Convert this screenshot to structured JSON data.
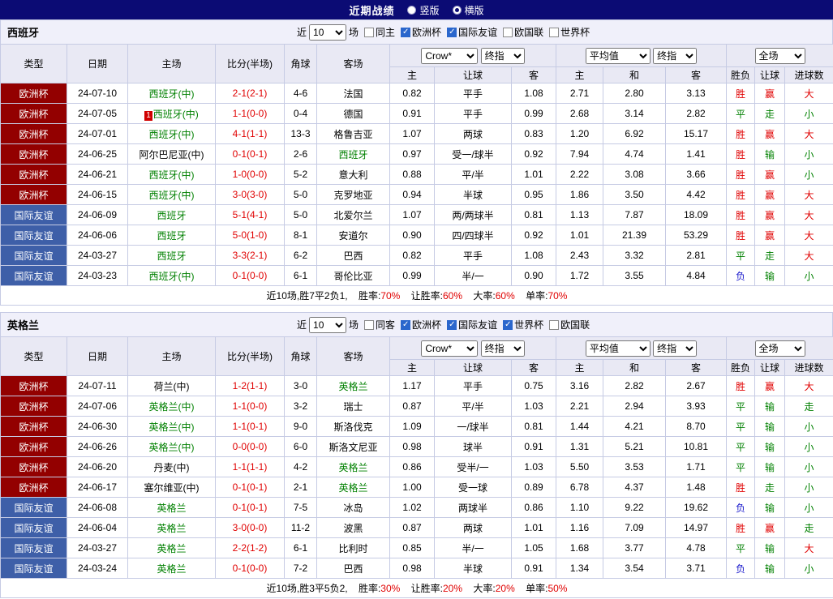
{
  "topbar": {
    "title": "近期战绩",
    "radios": [
      {
        "label": "竖版",
        "checked": false
      },
      {
        "label": "横版",
        "checked": true
      }
    ]
  },
  "table_header": {
    "type": "类型",
    "date": "日期",
    "home": "主场",
    "score": "比分(半场)",
    "corner": "角球",
    "away": "客场",
    "dd_crow": "Crow*",
    "dd_final": "终指",
    "dd_avg": "平均值",
    "dd_full": "全场",
    "sub_home": "主",
    "sub_handicap": "让球",
    "sub_away": "客",
    "sub_avg_home": "主",
    "sub_avg_draw": "和",
    "sub_avg_away": "客",
    "sub_result": "胜负",
    "sub_hresult": "让球",
    "sub_goals": "进球数"
  },
  "colors": {
    "euro_bg": "#930000",
    "friendly_bg": "#3e5fa8",
    "win": "#e00000",
    "draw": "#008000",
    "lose": "#1818cc",
    "topbar_bg": "#0b0b74"
  },
  "sections": [
    {
      "team": "西班牙",
      "filter": {
        "near": "近",
        "count": "10",
        "games": "场",
        "checkboxes": [
          {
            "label": "同主",
            "checked": false
          },
          {
            "label": "欧洲杯",
            "checked": true
          },
          {
            "label": "国际友谊",
            "checked": true
          },
          {
            "label": "欧国联",
            "checked": false
          },
          {
            "label": "世界杯",
            "checked": false
          }
        ]
      },
      "rows": [
        {
          "type": "欧洲杯",
          "type_class": "euro",
          "date": "24-07-10",
          "marker": "",
          "home": "西班牙(中)",
          "home_color": "green",
          "score": "2-1(2-1)",
          "corner": "4-6",
          "away": "法国",
          "away_color": "black",
          "odds_home": "0.82",
          "handicap": "平手",
          "odds_away": "1.08",
          "avg_home": "2.71",
          "avg_draw": "2.80",
          "avg_away": "3.13",
          "result": "胜",
          "result_color": "red",
          "hresult": "赢",
          "hresult_color": "red",
          "goals": "大",
          "goals_color": "red"
        },
        {
          "type": "欧洲杯",
          "type_class": "euro",
          "date": "24-07-05",
          "marker": "1",
          "home": "西班牙(中)",
          "home_color": "green",
          "score": "1-1(0-0)",
          "corner": "0-4",
          "away": "德国",
          "away_color": "black",
          "odds_home": "0.91",
          "handicap": "平手",
          "odds_away": "0.99",
          "avg_home": "2.68",
          "avg_draw": "3.14",
          "avg_away": "2.82",
          "result": "平",
          "result_color": "green",
          "hresult": "走",
          "hresult_color": "green",
          "goals": "小",
          "goals_color": "green"
        },
        {
          "type": "欧洲杯",
          "type_class": "euro",
          "date": "24-07-01",
          "marker": "",
          "home": "西班牙(中)",
          "home_color": "green",
          "score": "4-1(1-1)",
          "corner": "13-3",
          "away": "格鲁吉亚",
          "away_color": "black",
          "odds_home": "1.07",
          "handicap": "两球",
          "odds_away": "0.83",
          "avg_home": "1.20",
          "avg_draw": "6.92",
          "avg_away": "15.17",
          "result": "胜",
          "result_color": "red",
          "hresult": "赢",
          "hresult_color": "red",
          "goals": "大",
          "goals_color": "red"
        },
        {
          "type": "欧洲杯",
          "type_class": "euro",
          "date": "24-06-25",
          "marker": "",
          "home": "阿尔巴尼亚(中)",
          "home_color": "black",
          "score": "0-1(0-1)",
          "corner": "2-6",
          "away": "西班牙",
          "away_color": "green",
          "odds_home": "0.97",
          "handicap": "受一/球半",
          "odds_away": "0.92",
          "avg_home": "7.94",
          "avg_draw": "4.74",
          "avg_away": "1.41",
          "result": "胜",
          "result_color": "red",
          "hresult": "输",
          "hresult_color": "green",
          "goals": "小",
          "goals_color": "green"
        },
        {
          "type": "欧洲杯",
          "type_class": "euro",
          "date": "24-06-21",
          "marker": "",
          "home": "西班牙(中)",
          "home_color": "green",
          "score": "1-0(0-0)",
          "corner": "5-2",
          "away": "意大利",
          "away_color": "black",
          "odds_home": "0.88",
          "handicap": "平/半",
          "odds_away": "1.01",
          "avg_home": "2.22",
          "avg_draw": "3.08",
          "avg_away": "3.66",
          "result": "胜",
          "result_color": "red",
          "hresult": "赢",
          "hresult_color": "red",
          "goals": "小",
          "goals_color": "green"
        },
        {
          "type": "欧洲杯",
          "type_class": "euro",
          "date": "24-06-15",
          "marker": "",
          "home": "西班牙(中)",
          "home_color": "green",
          "score": "3-0(3-0)",
          "corner": "5-0",
          "away": "克罗地亚",
          "away_color": "black",
          "odds_home": "0.94",
          "handicap": "半球",
          "odds_away": "0.95",
          "avg_home": "1.86",
          "avg_draw": "3.50",
          "avg_away": "4.42",
          "result": "胜",
          "result_color": "red",
          "hresult": "赢",
          "hresult_color": "red",
          "goals": "大",
          "goals_color": "red"
        },
        {
          "type": "国际友谊",
          "type_class": "friendly",
          "date": "24-06-09",
          "marker": "",
          "home": "西班牙",
          "home_color": "green",
          "score": "5-1(4-1)",
          "corner": "5-0",
          "away": "北爱尔兰",
          "away_color": "black",
          "odds_home": "1.07",
          "handicap": "两/两球半",
          "odds_away": "0.81",
          "avg_home": "1.13",
          "avg_draw": "7.87",
          "avg_away": "18.09",
          "result": "胜",
          "result_color": "red",
          "hresult": "赢",
          "hresult_color": "red",
          "goals": "大",
          "goals_color": "red"
        },
        {
          "type": "国际友谊",
          "type_class": "friendly",
          "date": "24-06-06",
          "marker": "",
          "home": "西班牙",
          "home_color": "green",
          "score": "5-0(1-0)",
          "corner": "8-1",
          "away": "安道尔",
          "away_color": "black",
          "odds_home": "0.90",
          "handicap": "四/四球半",
          "odds_away": "0.92",
          "avg_home": "1.01",
          "avg_draw": "21.39",
          "avg_away": "53.29",
          "result": "胜",
          "result_color": "red",
          "hresult": "赢",
          "hresult_color": "red",
          "goals": "大",
          "goals_color": "red"
        },
        {
          "type": "国际友谊",
          "type_class": "friendly",
          "date": "24-03-27",
          "marker": "",
          "home": "西班牙",
          "home_color": "green",
          "score": "3-3(2-1)",
          "corner": "6-2",
          "away": "巴西",
          "away_color": "black",
          "odds_home": "0.82",
          "handicap": "平手",
          "odds_away": "1.08",
          "avg_home": "2.43",
          "avg_draw": "3.32",
          "avg_away": "2.81",
          "result": "平",
          "result_color": "green",
          "hresult": "走",
          "hresult_color": "green",
          "goals": "大",
          "goals_color": "red"
        },
        {
          "type": "国际友谊",
          "type_class": "friendly",
          "date": "24-03-23",
          "marker": "",
          "home": "西班牙(中)",
          "home_color": "green",
          "score": "0-1(0-0)",
          "corner": "6-1",
          "away": "哥伦比亚",
          "away_color": "black",
          "odds_home": "0.99",
          "handicap": "半/一",
          "odds_away": "0.90",
          "avg_home": "1.72",
          "avg_draw": "3.55",
          "avg_away": "4.84",
          "result": "负",
          "result_color": "blue",
          "hresult": "输",
          "hresult_color": "green",
          "goals": "小",
          "goals_color": "green"
        }
      ],
      "summary": {
        "prefix": "近10场,胜7平2负1,",
        "r1_label": "胜率:",
        "r1": "70%",
        "r2_label": "让胜率:",
        "r2": "60%",
        "r3_label": "大率:",
        "r3": "60%",
        "r4_label": "单率:",
        "r4": "70%"
      }
    },
    {
      "team": "英格兰",
      "filter": {
        "near": "近",
        "count": "10",
        "games": "场",
        "checkboxes": [
          {
            "label": "同客",
            "checked": false
          },
          {
            "label": "欧洲杯",
            "checked": true
          },
          {
            "label": "国际友谊",
            "checked": true
          },
          {
            "label": "世界杯",
            "checked": true
          },
          {
            "label": "欧国联",
            "checked": false
          }
        ]
      },
      "rows": [
        {
          "type": "欧洲杯",
          "type_class": "euro",
          "date": "24-07-11",
          "marker": "",
          "home": "荷兰(中)",
          "home_color": "black",
          "score": "1-2(1-1)",
          "corner": "3-0",
          "away": "英格兰",
          "away_color": "green",
          "odds_home": "1.17",
          "handicap": "平手",
          "odds_away": "0.75",
          "avg_home": "3.16",
          "avg_draw": "2.82",
          "avg_away": "2.67",
          "result": "胜",
          "result_color": "red",
          "hresult": "赢",
          "hresult_color": "red",
          "goals": "大",
          "goals_color": "red"
        },
        {
          "type": "欧洲杯",
          "type_class": "euro",
          "date": "24-07-06",
          "marker": "",
          "home": "英格兰(中)",
          "home_color": "green",
          "score": "1-1(0-0)",
          "corner": "3-2",
          "away": "瑞士",
          "away_color": "black",
          "odds_home": "0.87",
          "handicap": "平/半",
          "odds_away": "1.03",
          "avg_home": "2.21",
          "avg_draw": "2.94",
          "avg_away": "3.93",
          "result": "平",
          "result_color": "green",
          "hresult": "输",
          "hresult_color": "green",
          "goals": "走",
          "goals_color": "green"
        },
        {
          "type": "欧洲杯",
          "type_class": "euro",
          "date": "24-06-30",
          "marker": "",
          "home": "英格兰(中)",
          "home_color": "green",
          "score": "1-1(0-1)",
          "corner": "9-0",
          "away": "斯洛伐克",
          "away_color": "black",
          "odds_home": "1.09",
          "handicap": "一/球半",
          "odds_away": "0.81",
          "avg_home": "1.44",
          "avg_draw": "4.21",
          "avg_away": "8.70",
          "result": "平",
          "result_color": "green",
          "hresult": "输",
          "hresult_color": "green",
          "goals": "小",
          "goals_color": "green"
        },
        {
          "type": "欧洲杯",
          "type_class": "euro",
          "date": "24-06-26",
          "marker": "",
          "home": "英格兰(中)",
          "home_color": "green",
          "score": "0-0(0-0)",
          "corner": "6-0",
          "away": "斯洛文尼亚",
          "away_color": "black",
          "odds_home": "0.98",
          "handicap": "球半",
          "odds_away": "0.91",
          "avg_home": "1.31",
          "avg_draw": "5.21",
          "avg_away": "10.81",
          "result": "平",
          "result_color": "green",
          "hresult": "输",
          "hresult_color": "green",
          "goals": "小",
          "goals_color": "green"
        },
        {
          "type": "欧洲杯",
          "type_class": "euro",
          "date": "24-06-20",
          "marker": "",
          "home": "丹麦(中)",
          "home_color": "black",
          "score": "1-1(1-1)",
          "corner": "4-2",
          "away": "英格兰",
          "away_color": "green",
          "odds_home": "0.86",
          "handicap": "受半/一",
          "odds_away": "1.03",
          "avg_home": "5.50",
          "avg_draw": "3.53",
          "avg_away": "1.71",
          "result": "平",
          "result_color": "green",
          "hresult": "输",
          "hresult_color": "green",
          "goals": "小",
          "goals_color": "green"
        },
        {
          "type": "欧洲杯",
          "type_class": "euro",
          "date": "24-06-17",
          "marker": "",
          "home": "塞尔维亚(中)",
          "home_color": "black",
          "score": "0-1(0-1)",
          "corner": "2-1",
          "away": "英格兰",
          "away_color": "green",
          "odds_home": "1.00",
          "handicap": "受一球",
          "odds_away": "0.89",
          "avg_home": "6.78",
          "avg_draw": "4.37",
          "avg_away": "1.48",
          "result": "胜",
          "result_color": "red",
          "hresult": "走",
          "hresult_color": "green",
          "goals": "小",
          "goals_color": "green"
        },
        {
          "type": "国际友谊",
          "type_class": "friendly",
          "date": "24-06-08",
          "marker": "",
          "home": "英格兰",
          "home_color": "green",
          "score": "0-1(0-1)",
          "corner": "7-5",
          "away": "冰岛",
          "away_color": "black",
          "odds_home": "1.02",
          "handicap": "两球半",
          "odds_away": "0.86",
          "avg_home": "1.10",
          "avg_draw": "9.22",
          "avg_away": "19.62",
          "result": "负",
          "result_color": "blue",
          "hresult": "输",
          "hresult_color": "green",
          "goals": "小",
          "goals_color": "green"
        },
        {
          "type": "国际友谊",
          "type_class": "friendly",
          "date": "24-06-04",
          "marker": "",
          "home": "英格兰",
          "home_color": "green",
          "score": "3-0(0-0)",
          "corner": "11-2",
          "away": "波黑",
          "away_color": "black",
          "odds_home": "0.87",
          "handicap": "两球",
          "odds_away": "1.01",
          "avg_home": "1.16",
          "avg_draw": "7.09",
          "avg_away": "14.97",
          "result": "胜",
          "result_color": "red",
          "hresult": "赢",
          "hresult_color": "red",
          "goals": "走",
          "goals_color": "green"
        },
        {
          "type": "国际友谊",
          "type_class": "friendly",
          "date": "24-03-27",
          "marker": "",
          "home": "英格兰",
          "home_color": "green",
          "score": "2-2(1-2)",
          "corner": "6-1",
          "away": "比利时",
          "away_color": "black",
          "odds_home": "0.85",
          "handicap": "半/一",
          "odds_away": "1.05",
          "avg_home": "1.68",
          "avg_draw": "3.77",
          "avg_away": "4.78",
          "result": "平",
          "result_color": "green",
          "hresult": "输",
          "hresult_color": "green",
          "goals": "大",
          "goals_color": "red"
        },
        {
          "type": "国际友谊",
          "type_class": "friendly",
          "date": "24-03-24",
          "marker": "",
          "home": "英格兰",
          "home_color": "green",
          "score": "0-1(0-0)",
          "corner": "7-2",
          "away": "巴西",
          "away_color": "black",
          "odds_home": "0.98",
          "handicap": "半球",
          "odds_away": "0.91",
          "avg_home": "1.34",
          "avg_draw": "3.54",
          "avg_away": "3.71",
          "result": "负",
          "result_color": "blue",
          "hresult": "输",
          "hresult_color": "green",
          "goals": "小",
          "goals_color": "green"
        }
      ],
      "summary": {
        "prefix": "近10场,胜3平5负2,",
        "r1_label": "胜率:",
        "r1": "30%",
        "r2_label": "让胜率:",
        "r2": "20%",
        "r3_label": "大率:",
        "r3": "20%",
        "r4_label": "单率:",
        "r4": "50%"
      }
    }
  ]
}
